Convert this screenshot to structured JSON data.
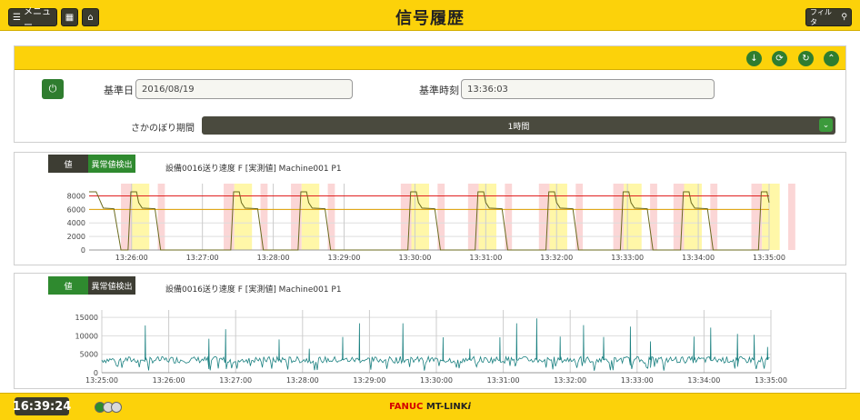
{
  "header": {
    "title": "信号履歴",
    "menu_label": "メニュー",
    "filter_label": "フィルタ"
  },
  "controls": {
    "base_date_label": "基準日",
    "base_date_value": "2016/08/19",
    "base_time_label": "基準時刻",
    "base_time_value": "13:36:03",
    "period_label": "さかのぼり期間",
    "period_value": "1時間"
  },
  "charts": [
    {
      "tab_value": "値",
      "tab_anomaly": "異常値検出",
      "active_tab": "anomaly",
      "title": "設備0016送り速度 F [実測値] Machine001 P1"
    },
    {
      "tab_value": "値",
      "tab_anomaly": "異常値検出",
      "active_tab": "value",
      "title": "設備0016送り速度 F [実測値] Machine001 P1"
    }
  ],
  "chart_data": [
    {
      "type": "line",
      "x_ticks": [
        "13:26:00",
        "13:27:00",
        "13:28:00",
        "13:29:00",
        "13:30:00",
        "13:31:00",
        "13:32:00",
        "13:33:00",
        "13:34:00",
        "13:35:00"
      ],
      "y_ticks": [
        0,
        2000,
        4000,
        6000,
        8000
      ],
      "ylim": [
        0,
        9000
      ],
      "upper_threshold": 8000,
      "lower_threshold": 6000,
      "grid": true,
      "colors": {
        "line": "#6b6b1e",
        "upper": "#e02020",
        "lower": "#e0a000",
        "band_yellow": "#fff7a8",
        "band_pink": "#fbd6d6"
      },
      "cycles_start_min": [
        25.95,
        27.4,
        28.35,
        29.9,
        30.85,
        31.85,
        32.9,
        33.75,
        34.85
      ],
      "values_pattern": [
        0,
        8600,
        8600,
        6200,
        6100,
        6100,
        0
      ]
    },
    {
      "type": "line",
      "x_ticks": [
        "13:25:00",
        "13:26:00",
        "13:27:00",
        "13:28:00",
        "13:29:00",
        "13:30:00",
        "13:31:00",
        "13:32:00",
        "13:33:00",
        "13:34:00",
        "13:35:00"
      ],
      "y_ticks": [
        0,
        5000,
        10000,
        15000
      ],
      "ylim": [
        0,
        16000
      ],
      "grid": true,
      "colors": {
        "line": "#1a8080"
      },
      "baseline": 3500,
      "spikes": [
        {
          "x": 25.65,
          "y": 12800
        },
        {
          "x": 26.6,
          "y": 9200
        },
        {
          "x": 26.85,
          "y": 11800
        },
        {
          "x": 27.65,
          "y": 9000
        },
        {
          "x": 28.1,
          "y": 6500
        },
        {
          "x": 28.6,
          "y": 9700
        },
        {
          "x": 28.85,
          "y": 13400
        },
        {
          "x": 29.5,
          "y": 13400
        },
        {
          "x": 30.1,
          "y": 9600
        },
        {
          "x": 30.5,
          "y": 6500
        },
        {
          "x": 30.95,
          "y": 9600
        },
        {
          "x": 31.2,
          "y": 13400
        },
        {
          "x": 31.5,
          "y": 14700
        },
        {
          "x": 31.85,
          "y": 9800
        },
        {
          "x": 32.2,
          "y": 12900
        },
        {
          "x": 32.5,
          "y": 9700
        },
        {
          "x": 32.9,
          "y": 12500
        },
        {
          "x": 33.2,
          "y": 8500
        },
        {
          "x": 33.85,
          "y": 9800
        },
        {
          "x": 34.1,
          "y": 12200
        },
        {
          "x": 34.5,
          "y": 10500
        },
        {
          "x": 34.75,
          "y": 10300
        },
        {
          "x": 34.95,
          "y": 7000
        },
        {
          "x": 35.1,
          "y": 14300
        }
      ]
    }
  ],
  "status": {
    "clock": "16:39:24",
    "brand_part1": "FANUC",
    "brand_part2": "MT-LINK",
    "brand_suffix": "i",
    "lamp_colors": [
      "#2c8c2c",
      "#d9d9d9",
      "#d9d9d9"
    ]
  }
}
